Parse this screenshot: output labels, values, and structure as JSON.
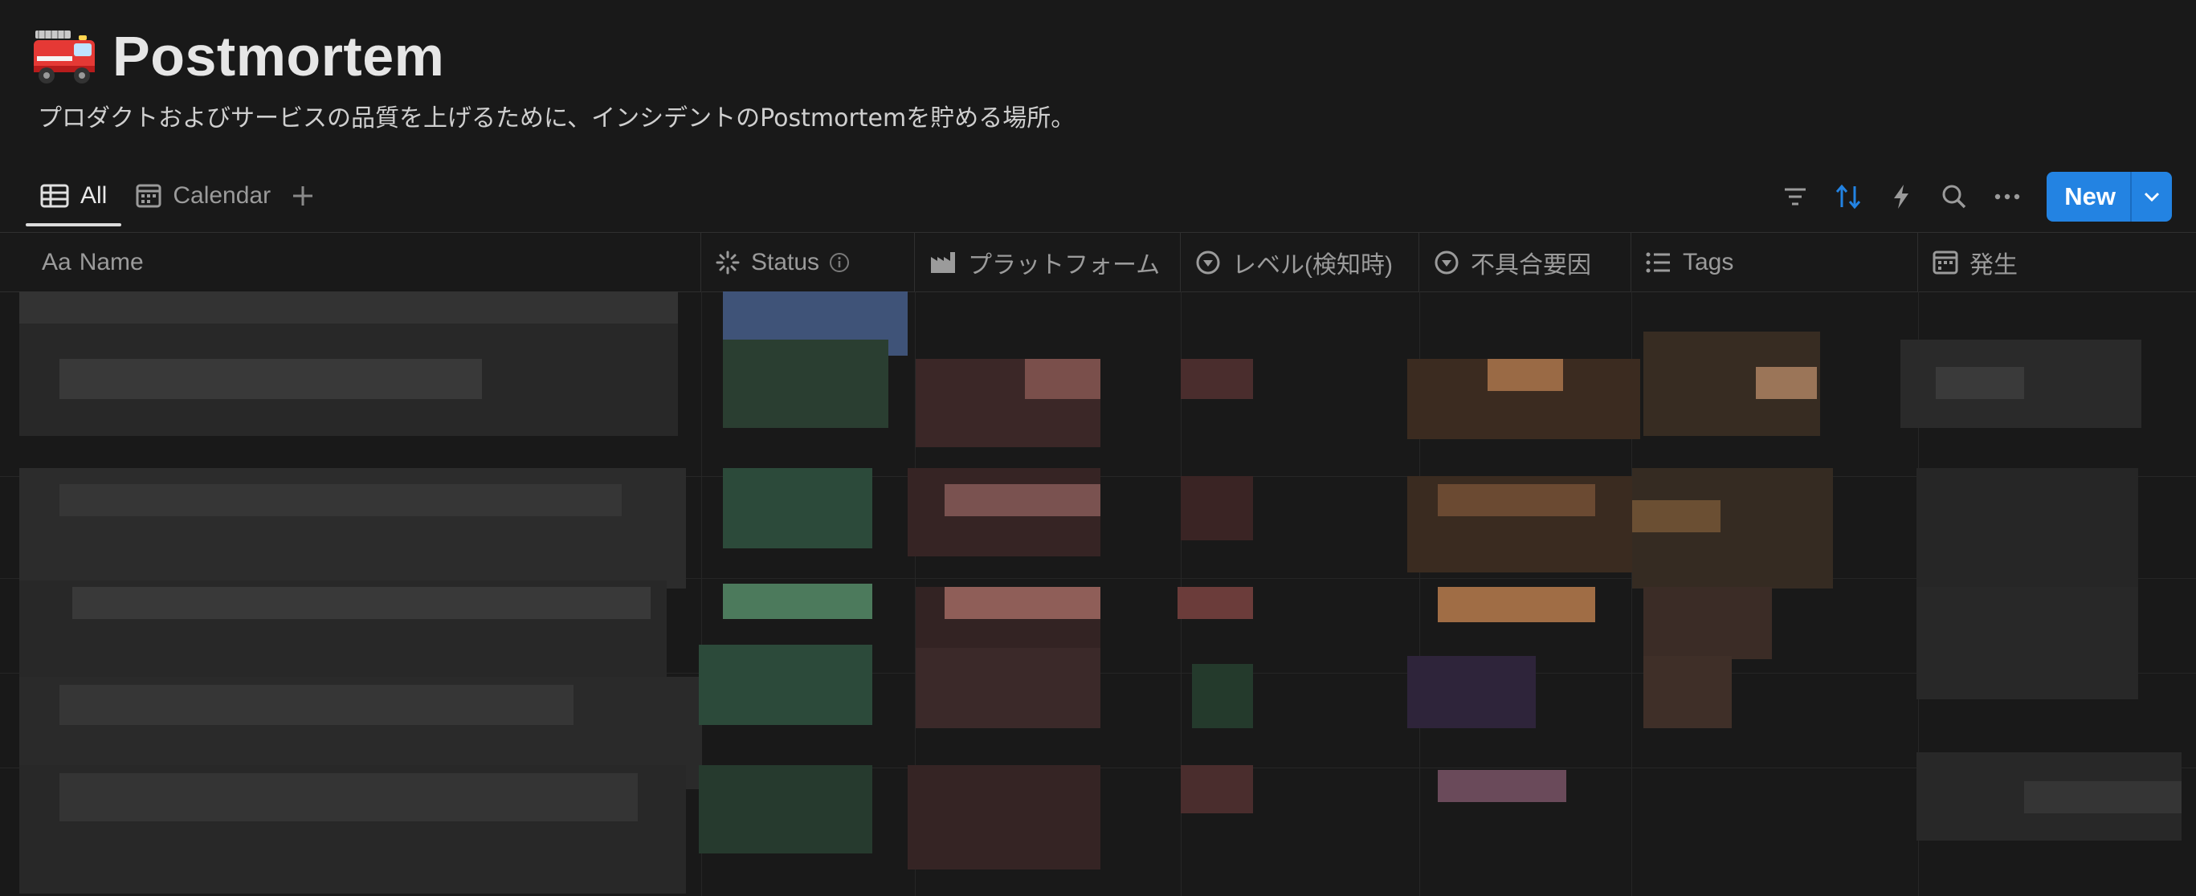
{
  "page": {
    "icon": "fire-engine-icon",
    "title": "Postmortem",
    "description": "プロダクトおよびサービスの品質を上げるために、インシデントのPostmortemを貯める場所。"
  },
  "views": [
    {
      "label": "All",
      "icon": "table-icon",
      "active": true
    },
    {
      "label": "Calendar",
      "icon": "calendar-icon",
      "active": false
    }
  ],
  "toolbar": {
    "icons": [
      "filter-icon",
      "sort-icon",
      "automation-icon",
      "search-icon",
      "more-icon"
    ],
    "new_label": "New",
    "accent": "#2383e2",
    "sort_active_color": "#2383e2"
  },
  "columns": [
    {
      "label": "Name",
      "icon": "aa-icon",
      "prefix": "Aa"
    },
    {
      "label": "Status",
      "icon": "status-icon"
    },
    {
      "label": "プラットフォーム",
      "icon": "factory-icon"
    },
    {
      "label": "レベル(検知時)",
      "icon": "select-icon"
    },
    {
      "label": "不具合要因",
      "icon": "select-icon"
    },
    {
      "label": "Tags",
      "icon": "list-icon"
    },
    {
      "label": "発生",
      "icon": "date-icon"
    }
  ],
  "rows_obscured": true
}
